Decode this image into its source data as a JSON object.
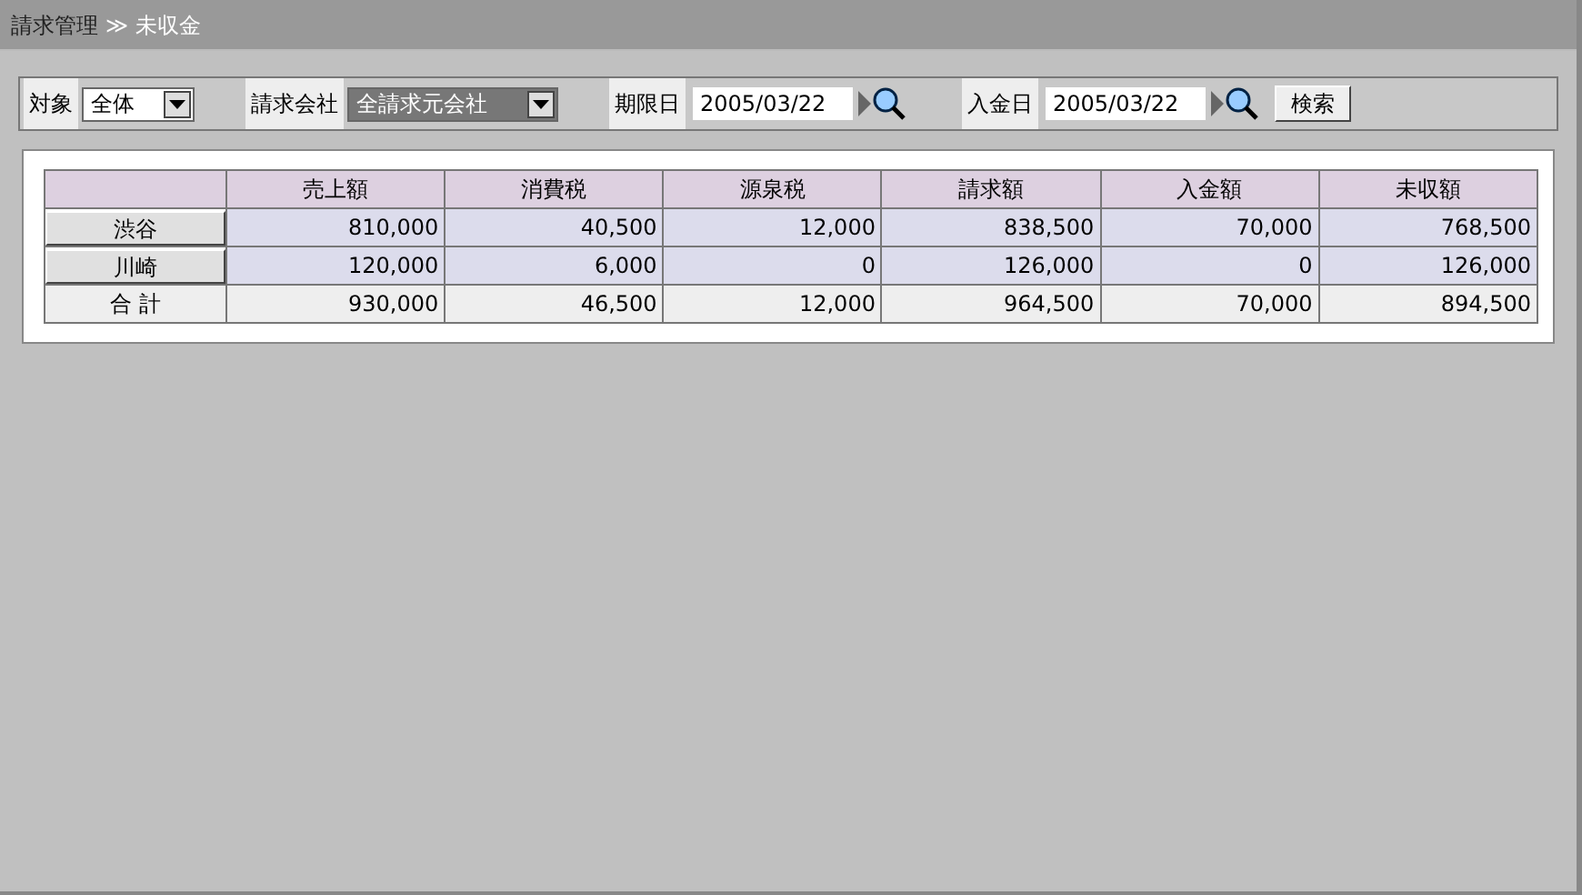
{
  "breadcrumb": {
    "parent": "請求管理",
    "separator": "≫",
    "current": "未収金"
  },
  "filters": [
    {
      "kind": "select",
      "label": "対象",
      "value": "全体",
      "highlighted": false
    },
    {
      "kind": "select",
      "label": "請求会社",
      "value": "全請求元会社",
      "highlighted": true
    },
    {
      "kind": "date",
      "label": "期限日",
      "value": "2005/03/22"
    },
    {
      "kind": "date",
      "label": "入金日",
      "value": "2005/03/22"
    }
  ],
  "search_button": "検索",
  "table": {
    "columns": [
      "売上額",
      "消費税",
      "源泉税",
      "請求額",
      "入金額",
      "未収額"
    ],
    "rows": [
      {
        "kind": "button",
        "label": "渋谷",
        "cells": [
          "810,000",
          "40,500",
          "12,000",
          "838,500",
          "70,000",
          "768,500"
        ]
      },
      {
        "kind": "button",
        "label": "川崎",
        "cells": [
          "120,000",
          "6,000",
          "0",
          "126,000",
          "0",
          "126,000"
        ]
      },
      {
        "kind": "total",
        "label": "合 計",
        "cells": [
          "930,000",
          "46,500",
          "12,000",
          "964,500",
          "70,000",
          "894,500"
        ]
      }
    ]
  }
}
